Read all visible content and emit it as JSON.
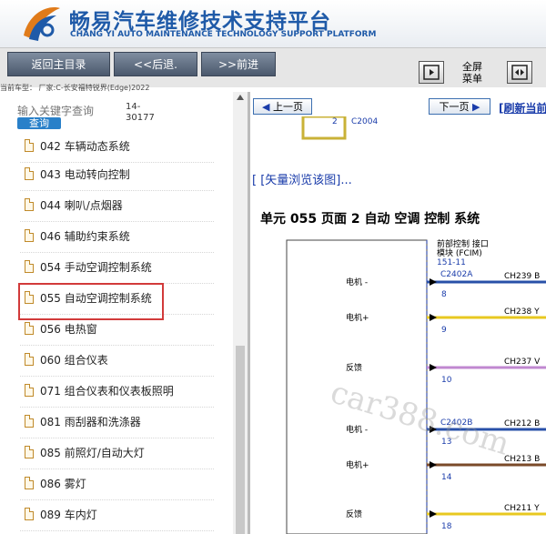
{
  "header": {
    "title_cn": "畅易汽车维修技术支持平台",
    "title_en": "CHANG YI AUTO MAINTENANCE TECHNOLOGY SUPPORT PLATFORM"
  },
  "toolbar": {
    "back_main": "返回主目录",
    "back": "<<后退.",
    "forward": ">>前进",
    "menu_line1": "全屏",
    "menu_line2": "菜单"
  },
  "car_info": "当前车型：  厂家:C-长安福特锐界(Edge)2022",
  "search": {
    "placeholder": "输入关键字查询",
    "button": "查询",
    "id_line1": "14-",
    "id_line2": "30177"
  },
  "systems": [
    {
      "label": "042 车辆动态系统"
    },
    {
      "label": "043 电动转向控制"
    },
    {
      "label": "044 喇叭/点烟器"
    },
    {
      "label": "046 辅助约束系统"
    },
    {
      "label": "054 手动空调控制系统"
    },
    {
      "label": "055 自动空调控制系统"
    },
    {
      "label": "056 电热窗"
    },
    {
      "label": "060 组合仪表"
    },
    {
      "label": "071 组合仪表和仪表板照明"
    },
    {
      "label": "081 雨刮器和洗涤器"
    },
    {
      "label": "085 前照灯/自动大灯"
    },
    {
      "label": "086 雾灯"
    },
    {
      "label": "089 车内灯"
    }
  ],
  "right": {
    "prev": "上一页",
    "next": "下一页",
    "refresh": "[刷新当前",
    "vector": "[ [矢量浏览该图]...",
    "section_title": "单元 055 页面 2 自动 空调 控制 系统"
  },
  "diagram": {
    "top_pin": "2",
    "top_conn": "C2004",
    "module_line1": "前部控制 接口",
    "module_line2": "模块 (FCIM)",
    "module_line3": "151-11",
    "connector_a": "C2402A",
    "connector_b": "C2402B",
    "rows": [
      {
        "label": "电机 -",
        "pin": "8",
        "circuit": "CH239 B",
        "color": "#2850a8"
      },
      {
        "label": "电机+",
        "pin": "9",
        "circuit": "CH238 Y",
        "color": "#e8c820"
      },
      {
        "label": "反馈",
        "pin": "10",
        "circuit": "CH237 V",
        "color": "#c088d0"
      },
      {
        "label": "电机 -",
        "pin": "13",
        "circuit": "CH212 B",
        "color": "#2850a8"
      },
      {
        "label": "电机+",
        "pin": "14",
        "circuit": "CH213 B",
        "color": "#7a4a28"
      },
      {
        "label": "反馈",
        "pin": "18",
        "circuit": "CH211 Y",
        "color": "#e8c820"
      }
    ]
  },
  "watermark": "car388.com"
}
